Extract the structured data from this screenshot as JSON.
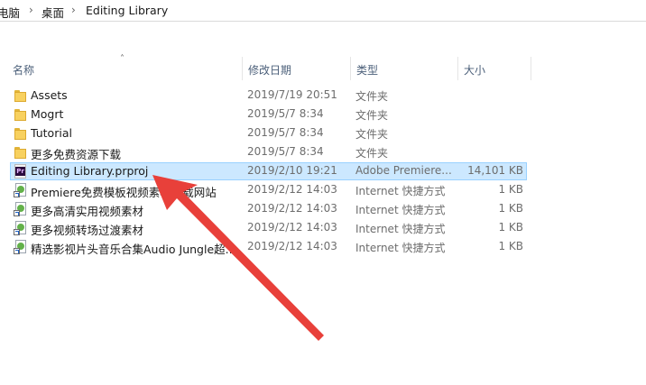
{
  "breadcrumb": {
    "items": [
      "电脑",
      "桌面",
      "Editing Library"
    ],
    "separator": "›"
  },
  "columns": {
    "name": "名称",
    "date": "修改日期",
    "type": "类型",
    "size": "大小"
  },
  "files": [
    {
      "name": "Assets",
      "date": "2019/7/19 20:51",
      "type": "文件夹",
      "size": "",
      "icon": "folder-icon"
    },
    {
      "name": "Mogrt",
      "date": "2019/5/7 8:34",
      "type": "文件夹",
      "size": "",
      "icon": "folder-icon"
    },
    {
      "name": "Tutorial",
      "date": "2019/5/7 8:34",
      "type": "文件夹",
      "size": "",
      "icon": "folder-icon"
    },
    {
      "name": "更多免费资源下载",
      "date": "2019/5/7 8:34",
      "type": "文件夹",
      "size": "",
      "icon": "folder-icon"
    },
    {
      "name": "Editing Library.prproj",
      "date": "2019/2/10 19:21",
      "type": "Adobe Premiere...",
      "size": "14,101 KB",
      "icon": "premiere-project-icon",
      "selected": true
    },
    {
      "name": "Premiere免费模板视频素材下载网站",
      "date": "2019/2/12 14:03",
      "type": "Internet 快捷方式",
      "size": "1 KB",
      "icon": "internet-shortcut-icon"
    },
    {
      "name": "更多高清实用视频素材",
      "date": "2019/2/12 14:03",
      "type": "Internet 快捷方式",
      "size": "1 KB",
      "icon": "internet-shortcut-icon"
    },
    {
      "name": "更多视频转场过渡素材",
      "date": "2019/2/12 14:03",
      "type": "Internet 快捷方式",
      "size": "1 KB",
      "icon": "internet-shortcut-icon"
    },
    {
      "name": "精选影视片头音乐合集Audio Jungle超...",
      "date": "2019/2/12 14:03",
      "type": "Internet 快捷方式",
      "size": "1 KB",
      "icon": "internet-shortcut-icon"
    }
  ],
  "premiere_badge": "Pr",
  "colors": {
    "selection_bg": "#cce8ff",
    "selection_border": "#99d1ff",
    "annotation_arrow": "#e8403a",
    "folder": "#f8d15f"
  }
}
